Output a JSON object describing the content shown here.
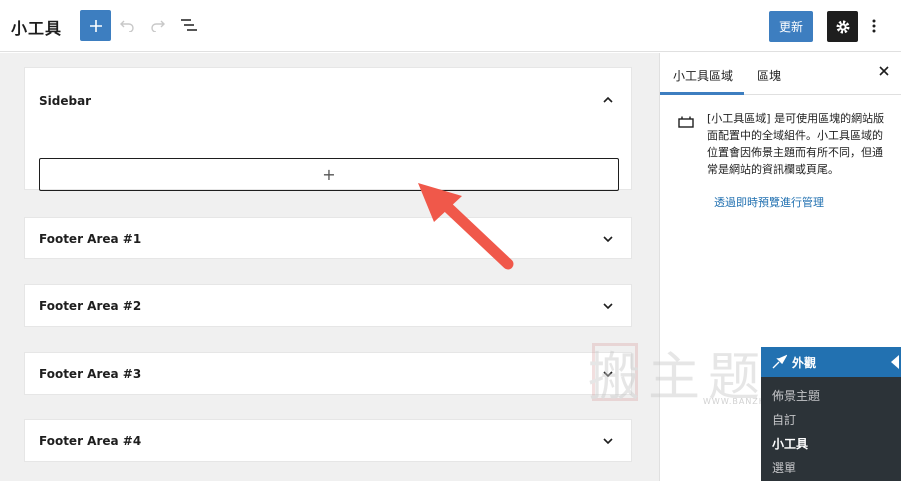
{
  "header": {
    "title": "小工具",
    "update_label": "更新"
  },
  "icons": {
    "add": "plus-icon",
    "undo": "undo-icon",
    "redo": "redo-icon",
    "list_view": "list-view-icon",
    "settings": "gear-icon",
    "more": "more-vertical-icon",
    "chevron_up": "chevron-up-icon",
    "chevron_down": "chevron-down-icon",
    "close": "close-icon",
    "widget_area": "block-area-icon",
    "appearance": "paintbrush-icon"
  },
  "colors": {
    "accent": "#3d7ec0",
    "link": "#2271b1",
    "admin_bg": "#2c3338",
    "annotation_arrow": "#f0584a"
  },
  "canvas": {
    "areas": [
      {
        "title": "Sidebar",
        "expanded": true
      },
      {
        "title": "Footer Area #1",
        "expanded": false
      },
      {
        "title": "Footer Area #2",
        "expanded": false
      },
      {
        "title": "Footer Area #3",
        "expanded": false
      },
      {
        "title": "Footer Area #4",
        "expanded": false
      }
    ],
    "appender_label": "+"
  },
  "panel": {
    "tabs": [
      {
        "label": "小工具區域",
        "active": true
      },
      {
        "label": "區塊",
        "active": false
      }
    ],
    "close_label": "✕",
    "description": "[小工具區域] 是可使用區塊的網站版面配置中的全域組件。小工具區域的位置會因佈景主題而有所不同，但通常是網站的資訊欄或頁尾。",
    "manage_link": "透過即時預覽進行管理"
  },
  "watermark": {
    "main": "搬主题",
    "sub": "WWW.BANZH"
  },
  "admin_menu": {
    "heading": "外觀",
    "items": [
      {
        "label": "佈景主題",
        "current": false
      },
      {
        "label": "自訂",
        "current": false
      },
      {
        "label": "小工具",
        "current": true
      },
      {
        "label": "選單",
        "current": false
      }
    ]
  }
}
